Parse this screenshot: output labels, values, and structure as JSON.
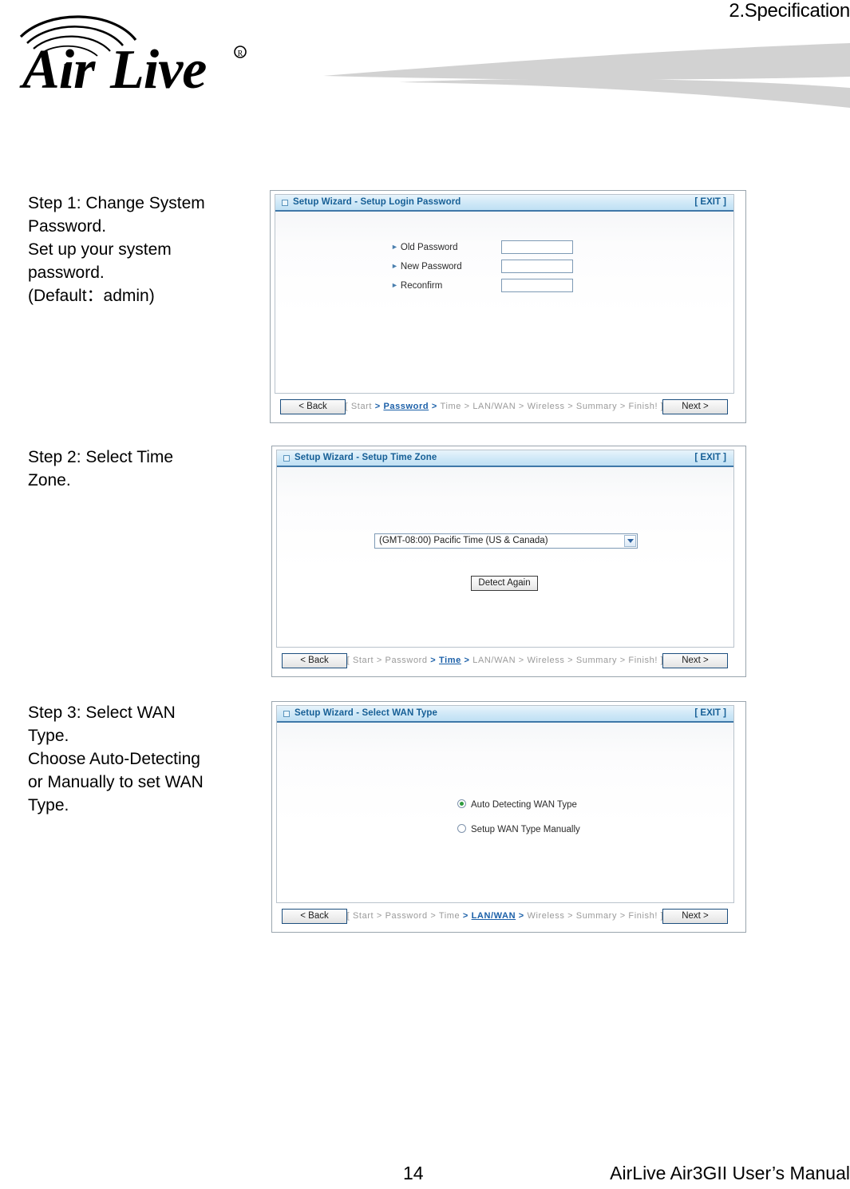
{
  "document": {
    "chapter_header": "2.Specification",
    "logo_text": "Air Live",
    "logo_registered": "®",
    "footer_page_number": "14",
    "footer_manual_title": "AirLive Air3GII User’s Manual"
  },
  "steps": [
    {
      "lines": [
        "Step 1: Change System",
        "Password.",
        "Set up your system",
        "password.",
        "(Default：admin)"
      ]
    },
    {
      "lines": [
        "Step 2: Select Time",
        "Zone."
      ]
    },
    {
      "lines": [
        "Step 3: Select WAN",
        "Type.",
        "Choose Auto-Detecting",
        "or Manually to set WAN",
        "Type."
      ]
    }
  ],
  "panels": [
    {
      "title": "Setup Wizard - Setup Login Password",
      "exit_label": "[ EXIT ]",
      "fields": [
        {
          "label": "Old Password",
          "value": "",
          "placeholder": ""
        },
        {
          "label": "New Password",
          "value": "",
          "placeholder": ""
        },
        {
          "label": "Reconfirm",
          "value": "",
          "placeholder": ""
        }
      ],
      "nav": {
        "back_label": "< Back",
        "next_label": "Next >",
        "breadcrumb_open": "[",
        "breadcrumb_close": "]",
        "breadcrumb_items": [
          "Start",
          "Password",
          "Time",
          "LAN/WAN",
          "Wireless",
          "Summary",
          "Finish!"
        ],
        "breadcrumb_active": "Password",
        "breadcrumb_separator": ">"
      }
    },
    {
      "title": "Setup Wizard - Setup Time Zone",
      "exit_label": "[ EXIT ]",
      "timezone_selected": "(GMT-08:00) Pacific Time (US & Canada)",
      "detect_button_label": "Detect Again",
      "nav": {
        "back_label": "< Back",
        "next_label": "Next >",
        "breadcrumb_open": "[",
        "breadcrumb_close": "]",
        "breadcrumb_items": [
          "Start",
          "Password",
          "Time",
          "LAN/WAN",
          "Wireless",
          "Summary",
          "Finish!"
        ],
        "breadcrumb_active": "Time",
        "breadcrumb_separator": ">"
      }
    },
    {
      "title": "Setup Wizard - Select WAN Type",
      "exit_label": "[ EXIT ]",
      "radios": [
        {
          "label": "Auto Detecting WAN Type",
          "checked": true
        },
        {
          "label": "Setup WAN Type Manually",
          "checked": false
        }
      ],
      "nav": {
        "back_label": "< Back",
        "next_label": "Next >",
        "breadcrumb_open": "[",
        "breadcrumb_close": "]",
        "breadcrumb_items": [
          "Start",
          "Password",
          "Time",
          "LAN/WAN",
          "Wireless",
          "Summary",
          "Finish!"
        ],
        "breadcrumb_active": "LAN/WAN",
        "breadcrumb_separator": ">"
      }
    }
  ],
  "colors": {
    "titlebar_text": "#165f96",
    "titlebar_border": "#3f78a8",
    "breadcrumb_inactive": "#9a9a9a",
    "breadcrumb_active": "#1a5fa8",
    "radio_selected": "#2e9b3e",
    "swoosh_gray": "#d2d2d2"
  }
}
